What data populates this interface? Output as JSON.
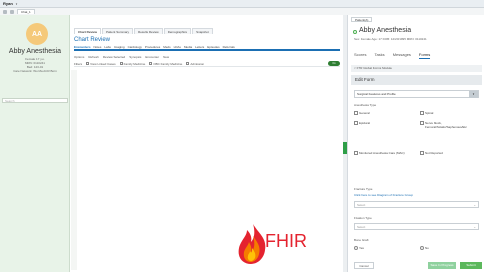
{
  "topbar": {
    "user": "Ryan",
    "tab": "Chat_1"
  },
  "patient": {
    "initials": "AA",
    "name": "Abby Anesthesia",
    "info": [
      "Female 17 y.o.",
      "MRN: 0110241",
      "Bed: 123-01",
      "Care Network: Wu Ma ACR Born"
    ],
    "search_placeholder": "Search"
  },
  "chart_tabs": [
    "Chart Review",
    "Patient Summary",
    "Results Review",
    "Demographics",
    "Snapshot"
  ],
  "chart_review": {
    "title": "Chart Review",
    "nav": [
      "Encounters",
      "Notes",
      "Labs",
      "Imaging",
      "Cardiology",
      "Procedures",
      "Meds",
      "LDAs",
      "Media",
      "Letters",
      "Episodes",
      "Referrals"
    ],
    "options": [
      "Options",
      "Refresh",
      "Review Selected",
      "Synopsis",
      "Encounter",
      "New"
    ],
    "filters": [
      "Filters",
      "View Linked Cases",
      "Family Medicine",
      "OBC Family Medicine",
      "Admission"
    ],
    "toggle": "On"
  },
  "anesthesia": {
    "tab_label": "Patient(A)",
    "name": "Abby Anesthesia",
    "info": "Sex: Female  Age: 17  DOB: 12/20/1995  MRN: 0110241",
    "tabs": [
      "Scores",
      "Tasks",
      "Messages",
      "Forms"
    ],
    "active_tab": "Forms",
    "breadcrumb": "< FTR Global Forms Module",
    "edit_form": "Edit Form",
    "section": "Surgical Features and Profile",
    "anesthesia_type_label": "Anesthesia Type",
    "types": [
      "General",
      "Spinal",
      "Epidural",
      "Nerve block, Femoral/Sciatic/Saphenous/Etc",
      "Monitored Anesthesia Care (MAC)",
      "Not Reported"
    ],
    "fracture_type_label": "Fracture Type",
    "fracture_link": "Click here to see Diagram of Fracture Group",
    "select_placeholder": "Select",
    "fixation_label": "Fixation Type",
    "bone_graft_label": "Bone Graft",
    "yes": "Yes",
    "no": "No",
    "cancel": "Cancel",
    "save_progress": "Save In Progress",
    "submit": "Submit"
  },
  "logo": {
    "text": "FHIR"
  },
  "colors": {
    "accent": "#1b6fb3",
    "panel_green": "#e8f3e8",
    "logo_red": "#e4232f",
    "submit_green": "#5cb85c"
  }
}
